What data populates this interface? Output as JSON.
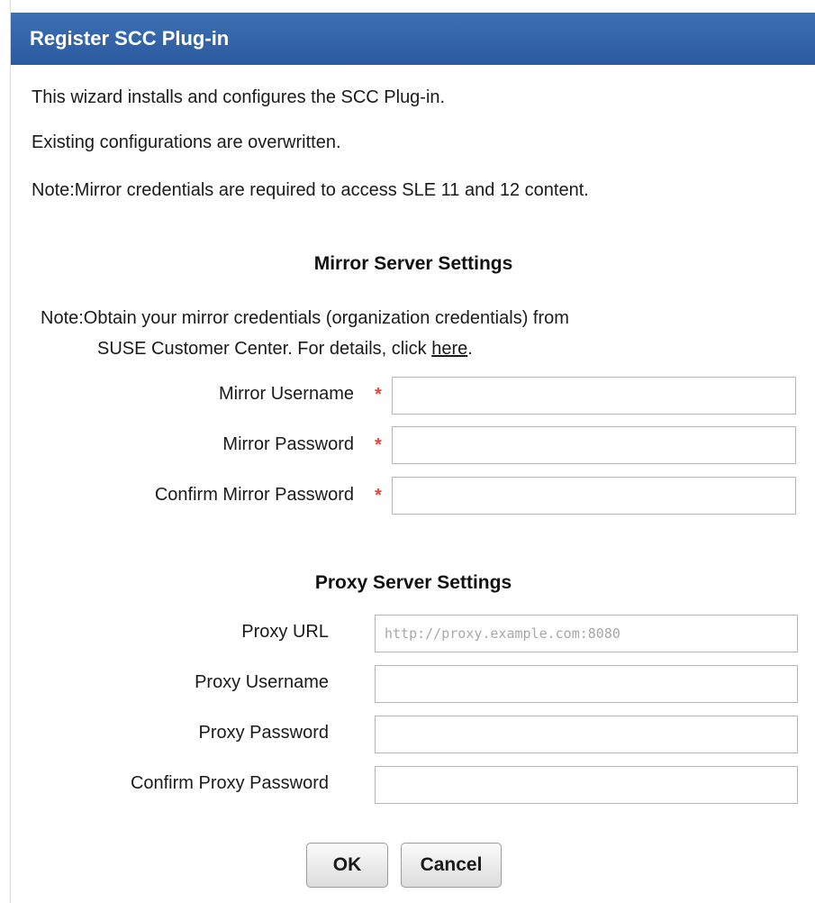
{
  "dialog": {
    "title": "Register SCC Plug-in"
  },
  "intro": {
    "line1": "This wizard installs and configures the SCC Plug-in.",
    "line2": "Existing configurations are overwritten.",
    "line3": "Note:Mirror credentials are required to access SLE 11 and 12 content."
  },
  "mirror": {
    "section_title": "Mirror Server Settings",
    "note_prefix": "Note:Obtain your mirror credentials (organization credentials) from",
    "note_line2": "SUSE Customer Center. For details, click ",
    "note_link": "here",
    "note_end": ".",
    "required_marker": "*",
    "fields": {
      "username_label": "Mirror Username",
      "username_value": "",
      "password_label": "Mirror Password",
      "password_value": "",
      "confirm_label": "Confirm Mirror Password",
      "confirm_value": ""
    }
  },
  "proxy": {
    "section_title": "Proxy Server Settings",
    "fields": {
      "url_label": "Proxy URL",
      "url_placeholder": "http://proxy.example.com:8080",
      "url_value": "",
      "username_label": "Proxy Username",
      "username_value": "",
      "password_label": "Proxy Password",
      "password_value": "",
      "confirm_label": "Confirm Proxy Password",
      "confirm_value": ""
    }
  },
  "buttons": {
    "ok": "OK",
    "cancel": "Cancel"
  }
}
